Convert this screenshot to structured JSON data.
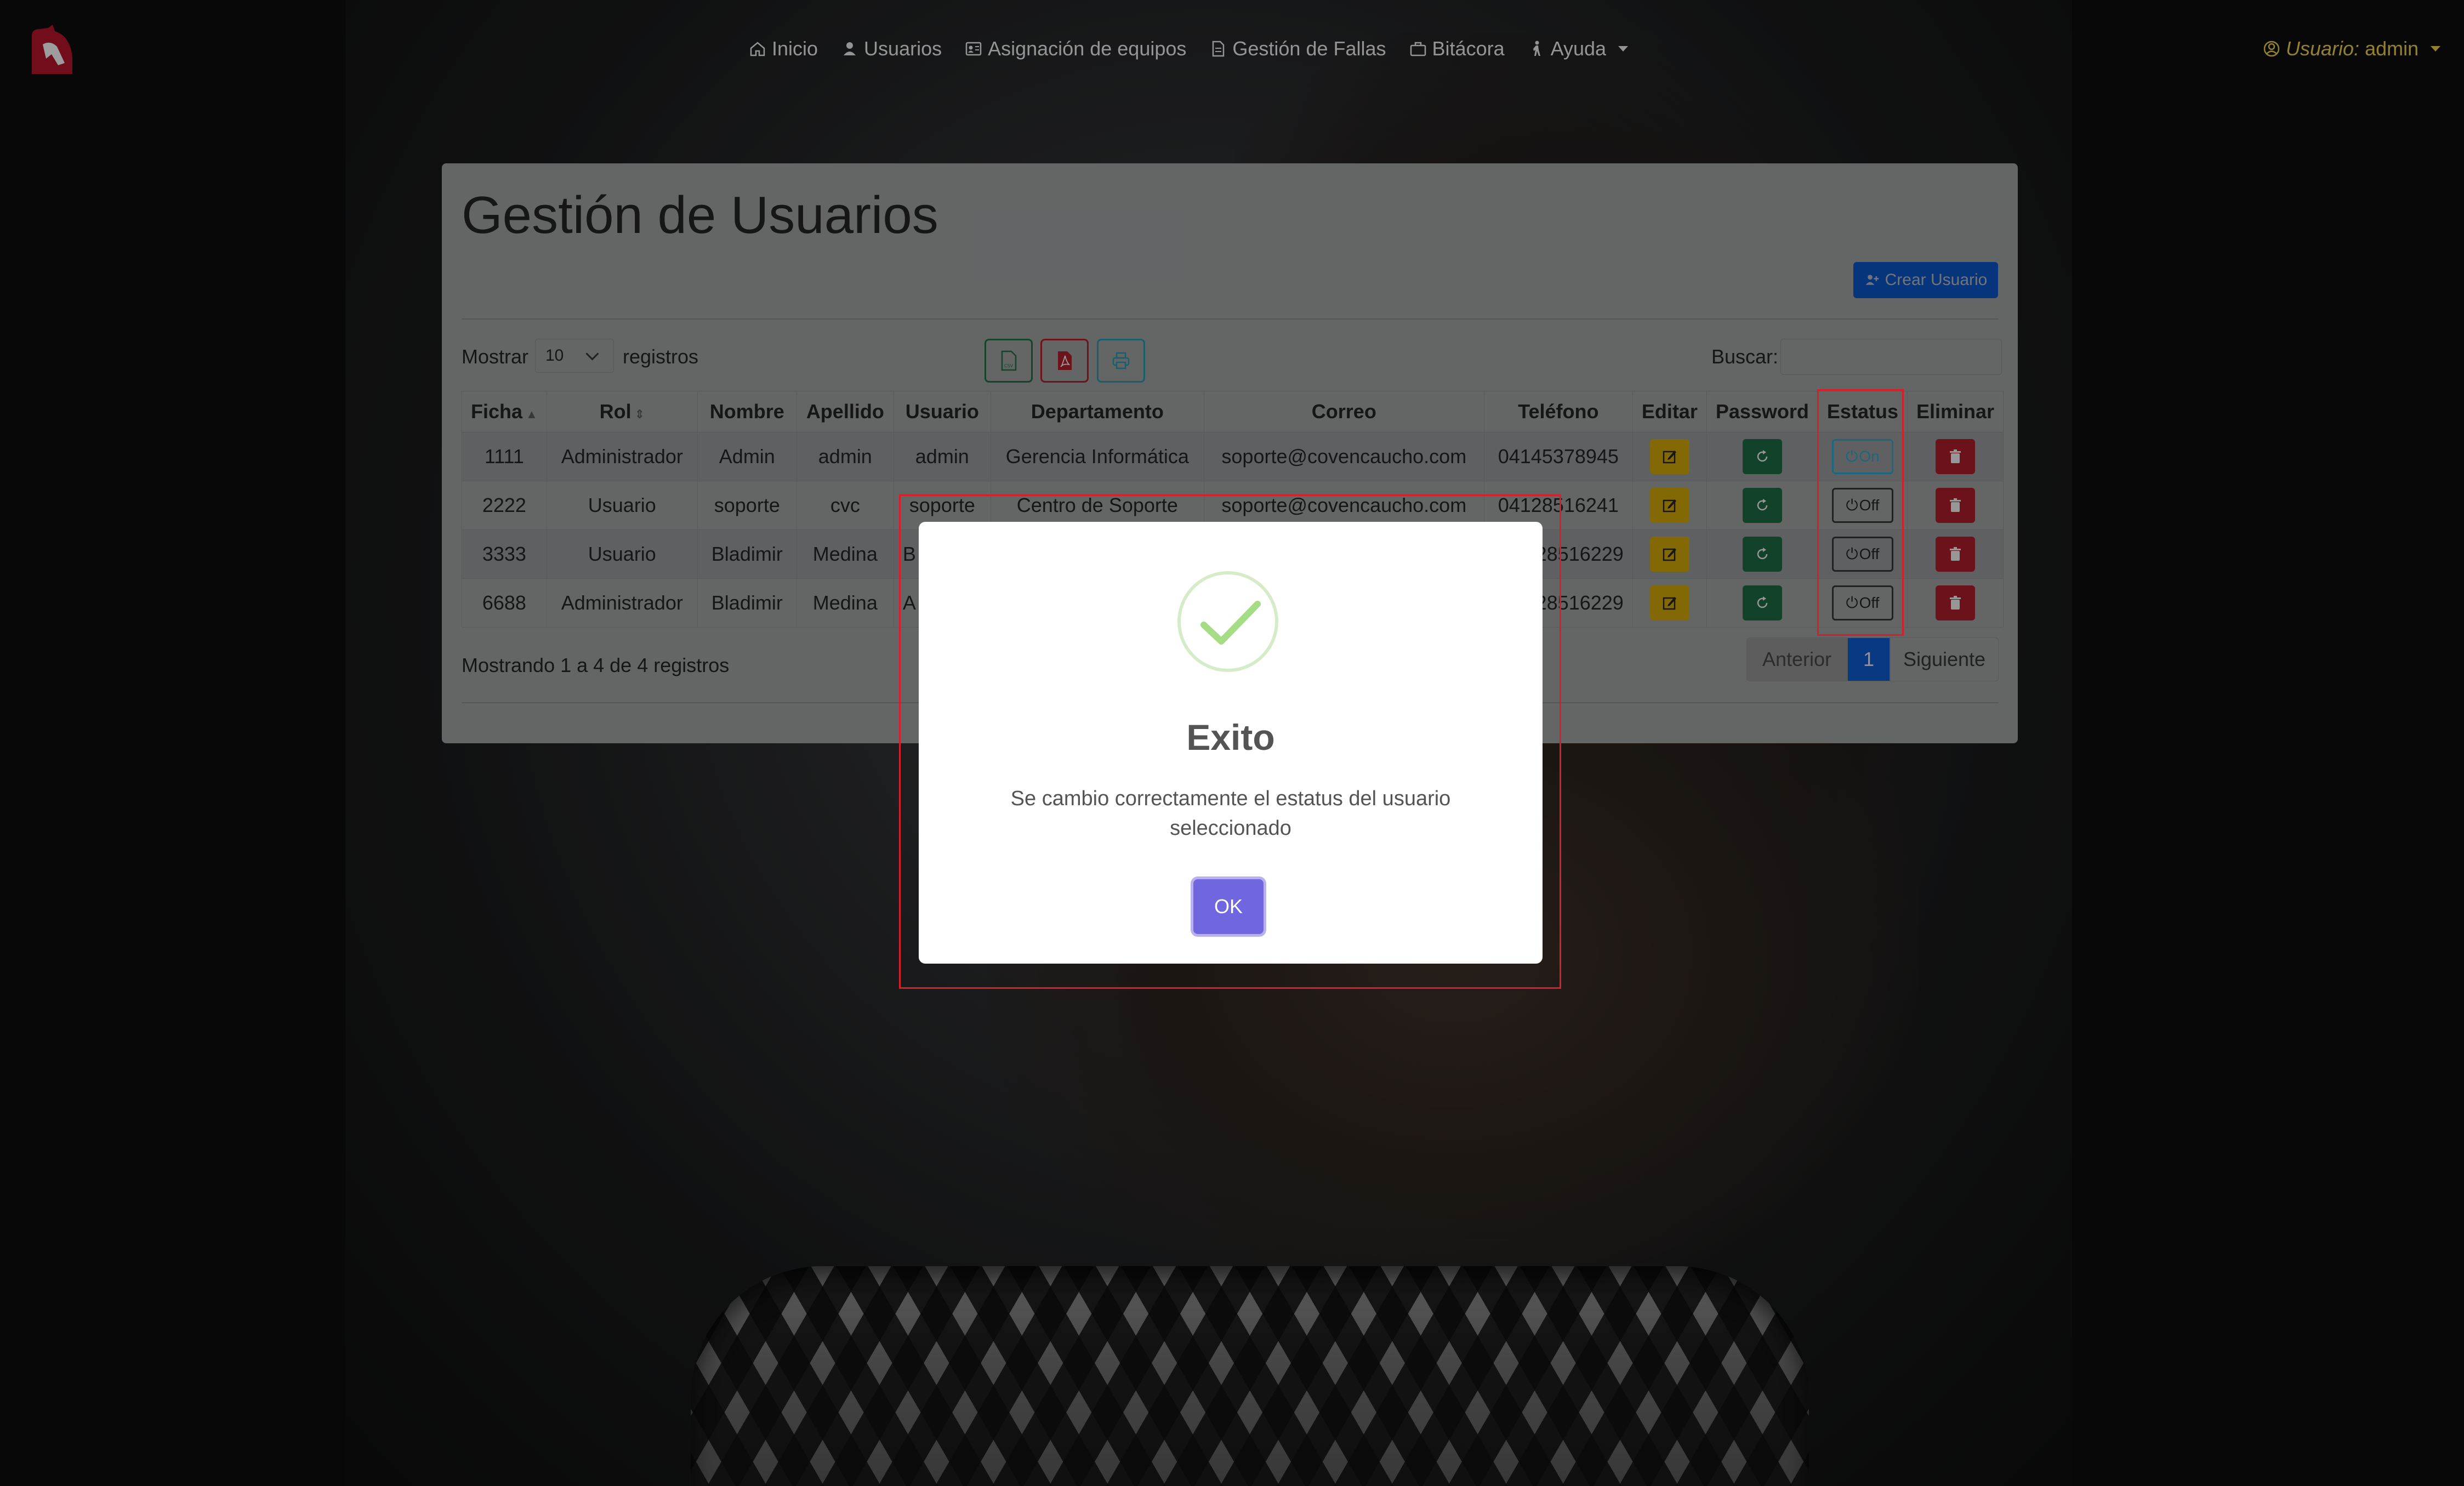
{
  "nav": {
    "items": [
      {
        "label": "Inicio",
        "icon": "home-icon"
      },
      {
        "label": "Usuarios",
        "icon": "person-icon"
      },
      {
        "label": "Asignación de equipos",
        "icon": "person-card-icon"
      },
      {
        "label": "Gestión de Fallas",
        "icon": "document-icon"
      },
      {
        "label": "Bitácora",
        "icon": "briefcase-icon"
      },
      {
        "label": "Ayuda",
        "icon": "person-walking-icon"
      }
    ],
    "user_prefix": "Usuario:",
    "user_name": "admin"
  },
  "page": {
    "title": "Gestión de Usuarios",
    "create_button": "Crear Usuario",
    "show_label": "Mostrar",
    "page_length": "10",
    "records_label": "registros",
    "search_label": "Buscar:",
    "search_value": ""
  },
  "table": {
    "headers": [
      "Ficha",
      "Rol",
      "Nombre",
      "Apellido",
      "Usuario",
      "Departamento",
      "Correo",
      "Teléfono",
      "Editar",
      "Password",
      "Estatus",
      "Eliminar"
    ],
    "rows": [
      {
        "ficha": "1111",
        "rol": "Administrador",
        "nombre": "Admin",
        "apellido": "admin",
        "usuario": "admin",
        "departamento": "Gerencia Informática",
        "correo": "soporte@covencaucho.com",
        "telefono": "04145378945",
        "estatus": "On"
      },
      {
        "ficha": "2222",
        "rol": "Usuario",
        "nombre": "soporte",
        "apellido": "cvc",
        "usuario": "soporte",
        "departamento": "Centro de Soporte",
        "correo": "soporte@covencaucho.com",
        "telefono": "04128516241",
        "estatus": "Off"
      },
      {
        "ficha": "3333",
        "rol": "Usuario",
        "nombre": "Bladimir",
        "apellido": "Medina",
        "usuario": "B",
        "departamento": "",
        "correo": "",
        "telefono": "28516229",
        "estatus": "Off"
      },
      {
        "ficha": "6688",
        "rol": "Administrador",
        "nombre": "Bladimir",
        "apellido": "Medina",
        "usuario": "A",
        "departamento": "",
        "correo": "",
        "telefono": "28516229",
        "estatus": "Off"
      }
    ],
    "info": "Mostrando 1 a 4 de 4 registros",
    "pager": {
      "prev": "Anterior",
      "current": "1",
      "next": "Siguiente"
    }
  },
  "modal": {
    "title": "Exito",
    "message": "Se cambio correctamente el estatus del usuario seleccionado",
    "ok_label": "OK"
  },
  "colors": {
    "primary": "#0d6efd",
    "warning": "#ffc107",
    "success": "#198754",
    "danger": "#dc3545",
    "modal_button": "#7066e0",
    "user_accent": "#e0c84a"
  }
}
